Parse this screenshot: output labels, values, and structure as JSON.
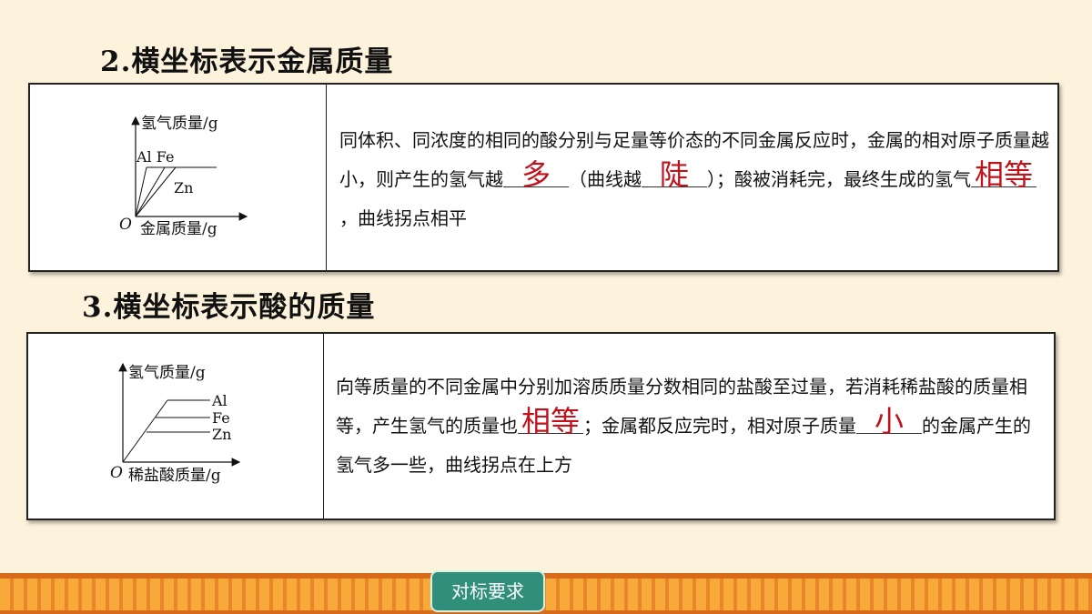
{
  "section2": {
    "title": "2.横坐标表示金属质量",
    "graph": {
      "y_label": "氢气质量/g",
      "x_label": "金属质量/g",
      "origin": "O",
      "label_al_fe": "Al Fe",
      "label_zn": "Zn"
    },
    "text": {
      "part1": "同体积、同浓度的相同的酸分别与足量等价态的不同金属反应时，金属的相对原子质量越小，则产生的氢气越",
      "blank1": "多",
      "part2": "（曲线越",
      "blank2": "陡",
      "part3": "）；酸被消耗完，最终生成的氢气",
      "blank3": "相等",
      "part4": "，曲线拐点相平"
    }
  },
  "section3": {
    "title": "3.横坐标表示酸的质量",
    "graph": {
      "y_label": "氢气质量/g",
      "x_label": "稀盐酸质量/g",
      "origin": "O",
      "label_al": "Al",
      "label_fe": "Fe",
      "label_zn": "Zn"
    },
    "text": {
      "part1": "向等质量的不同金属中分别加溶质质量分数相同的盐酸至过量，若消耗稀盐酸的质量相等，产生氢气的质量也",
      "blank1": "相等",
      "part2": "；金属都反应完时，相对原子质量",
      "blank2": "小",
      "part3": "的金属产生的氢气多一些，曲线拐点在上方"
    }
  },
  "footer": {
    "button_label": "对标要求"
  },
  "colors": {
    "background": "#fdf3dc",
    "answer_red": "#c1121c",
    "button_teal": "#2f8f7a",
    "footer_orange": "#f7a93a"
  }
}
